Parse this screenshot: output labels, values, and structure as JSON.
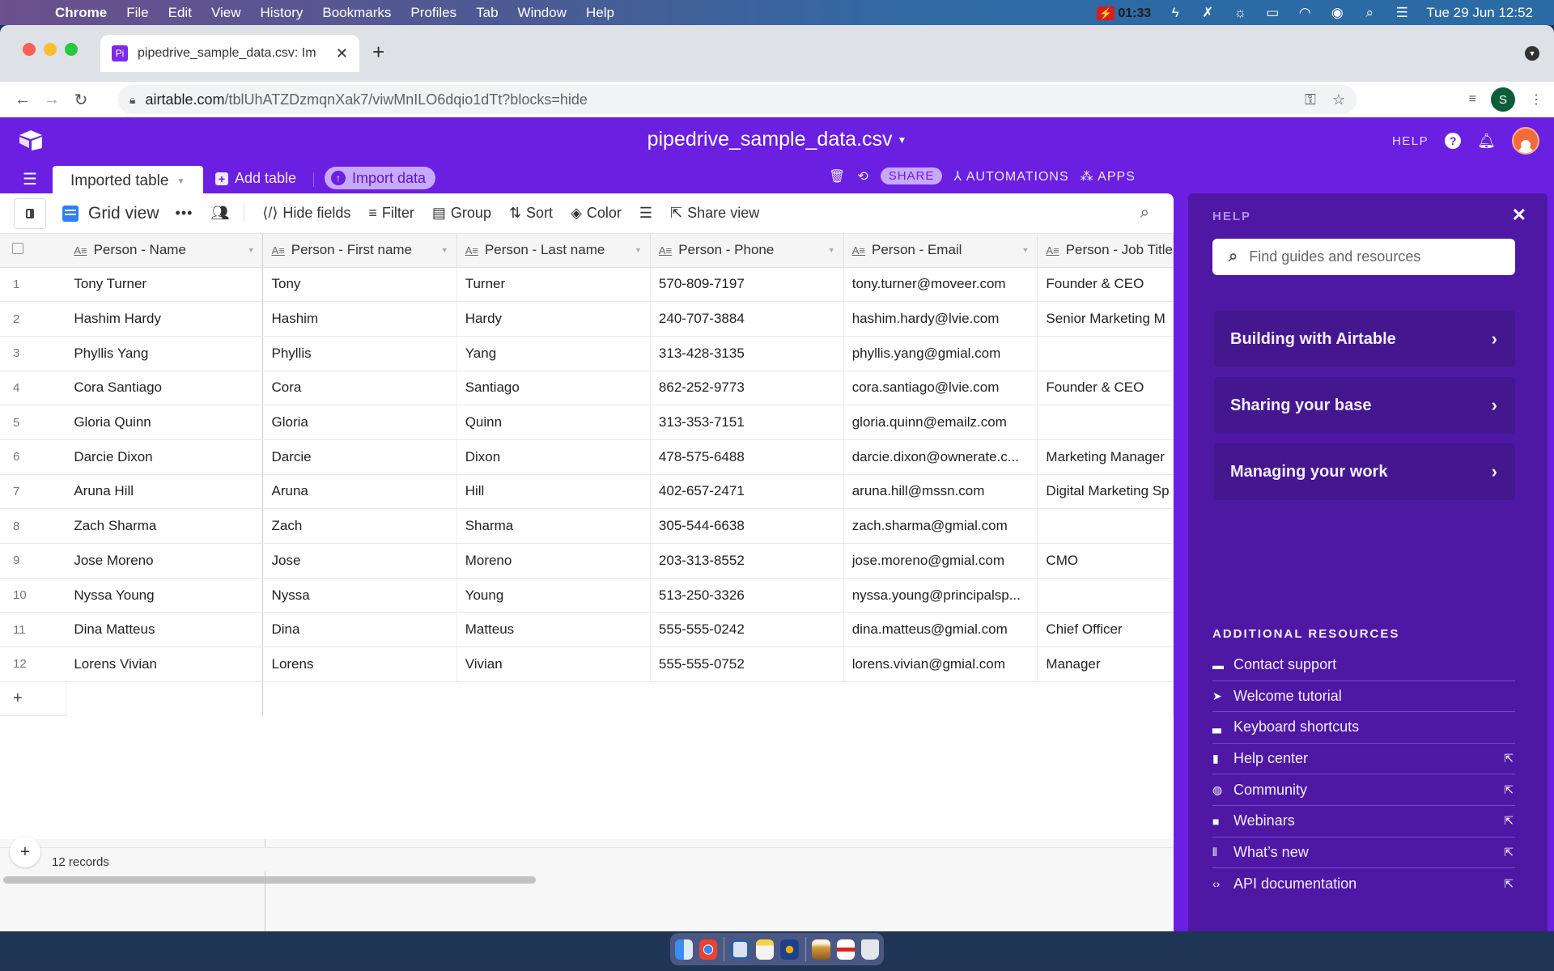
{
  "menubar": {
    "app": "Chrome",
    "items": [
      "File",
      "Edit",
      "View",
      "History",
      "Bookmarks",
      "Profiles",
      "Tab",
      "Window",
      "Help"
    ],
    "recording_time": "01:33",
    "datetime": "Tue 29 Jun  12:52"
  },
  "browser": {
    "tab_title": "pipedrive_sample_data.csv: Im",
    "tab_favicon": "Pi",
    "url_host": "airtable.com",
    "url_path": "/tblUhATZDzmqnXak7/viwMnILO6dqio1dTt?blocks=hide",
    "profile_initial": "S"
  },
  "app": {
    "base_title": "pipedrive_sample_data.csv",
    "help_label": "HELP",
    "table_tab": "Imported table",
    "add_table": "Add table",
    "import_data": "Import data",
    "share": "SHARE",
    "automations": "AUTOMATIONS",
    "apps": "APPS",
    "accent_color": "#6b1fe0"
  },
  "viewbar": {
    "view_name": "Grid view",
    "hide_fields": "Hide fields",
    "filter": "Filter",
    "group": "Group",
    "sort": "Sort",
    "color": "Color",
    "share_view": "Share view"
  },
  "grid": {
    "columns": [
      "Person - Name",
      "Person - First name",
      "Person - Last name",
      "Person - Phone",
      "Person - Email",
      "Person - Job Title"
    ],
    "rows": [
      {
        "n": "1",
        "name": "Tony Turner",
        "first": "Tony",
        "last": "Turner",
        "phone": "570-809-7197",
        "email": "tony.turner@moveer.com",
        "job": "Founder & CEO"
      },
      {
        "n": "2",
        "name": "Hashim Hardy",
        "first": "Hashim",
        "last": "Hardy",
        "phone": "240-707-3884",
        "email": "hashim.hardy@lvie.com",
        "job": "Senior Marketing M"
      },
      {
        "n": "3",
        "name": "Phyllis Yang",
        "first": "Phyllis",
        "last": "Yang",
        "phone": "313-428-3135",
        "email": "phyllis.yang@gmial.com",
        "job": ""
      },
      {
        "n": "4",
        "name": "Cora Santiago",
        "first": "Cora",
        "last": "Santiago",
        "phone": "862-252-9773",
        "email": "cora.santiago@lvie.com",
        "job": "Founder & CEO"
      },
      {
        "n": "5",
        "name": "Gloria Quinn",
        "first": "Gloria",
        "last": "Quinn",
        "phone": "313-353-7151",
        "email": "gloria.quinn@emailz.com",
        "job": ""
      },
      {
        "n": "6",
        "name": "Darcie Dixon",
        "first": "Darcie",
        "last": "Dixon",
        "phone": "478-575-6488",
        "email": "darcie.dixon@ownerate.c...",
        "job": "Marketing Manager"
      },
      {
        "n": "7",
        "name": "Aruna Hill",
        "first": "Aruna",
        "last": "Hill",
        "phone": "402-657-2471",
        "email": "aruna.hill@mssn.com",
        "job": "Digital Marketing Sp"
      },
      {
        "n": "8",
        "name": "Zach Sharma",
        "first": "Zach",
        "last": "Sharma",
        "phone": "305-544-6638",
        "email": "zach.sharma@gmial.com",
        "job": ""
      },
      {
        "n": "9",
        "name": "Jose Moreno",
        "first": "Jose",
        "last": "Moreno",
        "phone": "203-313-8552",
        "email": "jose.moreno@gmial.com",
        "job": "CMO"
      },
      {
        "n": "10",
        "name": "Nyssa Young",
        "first": "Nyssa",
        "last": "Young",
        "phone": "513-250-3326",
        "email": "nyssa.young@principalsp...",
        "job": ""
      },
      {
        "n": "11",
        "name": "Dina Matteus",
        "first": "Dina",
        "last": "Matteus",
        "phone": "555-555-0242",
        "email": "dina.matteus@gmial.com",
        "job": "Chief Officer"
      },
      {
        "n": "12",
        "name": "Lorens Vivian",
        "first": "Lorens",
        "last": "Vivian",
        "phone": "555-555-0752",
        "email": "lorens.vivian@gmial.com",
        "job": "Manager"
      }
    ],
    "record_count": "12 records"
  },
  "help_panel": {
    "title": "HELP",
    "search_placeholder": "Find guides and resources",
    "cards": [
      "Building with Airtable",
      "Sharing your base",
      "Managing your work"
    ],
    "resources_title": "ADDITIONAL RESOURCES",
    "resources": [
      {
        "label": "Contact support",
        "icon": "chat-icon",
        "glyph": "▬",
        "external": false
      },
      {
        "label": "Welcome tutorial",
        "icon": "cursor-icon",
        "glyph": "➤",
        "external": false
      },
      {
        "label": "Keyboard shortcuts",
        "icon": "laptop-icon",
        "glyph": "▃",
        "external": false
      },
      {
        "label": "Help center",
        "icon": "book-icon",
        "glyph": "▮",
        "external": true
      },
      {
        "label": "Community",
        "icon": "globe-icon",
        "glyph": "◍",
        "external": true
      },
      {
        "label": "Webinars",
        "icon": "video-icon",
        "glyph": "■",
        "external": true
      },
      {
        "label": "What’s new",
        "icon": "gift-icon",
        "glyph": "⫴",
        "external": true
      },
      {
        "label": "API documentation",
        "icon": "code-icon",
        "glyph": "‹›",
        "external": true
      }
    ]
  }
}
